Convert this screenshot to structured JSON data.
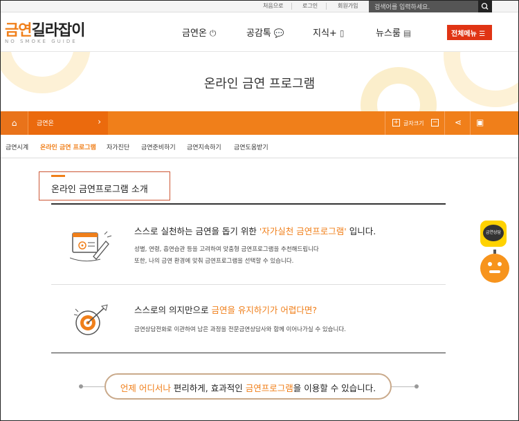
{
  "util_bar": {
    "links": [
      "처음으로",
      "로그인",
      "회원가입"
    ],
    "search_placeholder": "검색어를 입력하세요.",
    "search_icon": "search-icon"
  },
  "logo": {
    "text_orange": "금연",
    "text_dark": "길라잡이",
    "subtitle": "NO SMOKE GUIDE"
  },
  "gnb": [
    {
      "label": "금연온",
      "icon": "power-icon"
    },
    {
      "label": "공감톡",
      "icon": "chat-bubble-icon"
    },
    {
      "label": "지식+",
      "icon": "book-icon"
    },
    {
      "label": "뉴스룸",
      "icon": "newspaper-icon"
    }
  ],
  "all_menu": {
    "label": "전체메뉴",
    "icon": "menu-icon"
  },
  "hero": {
    "title": "온라인 금연 프로그램"
  },
  "navbar": {
    "home_icon": "home-icon",
    "current": "금연온",
    "font_size_label": "글자크기",
    "share_icon": "share-icon",
    "print_icon": "print-icon"
  },
  "subtabs": [
    "금연시계",
    "온라인 금연 프로그램",
    "자가진단",
    "금연준비하기",
    "금연지속하기",
    "금연도움받기"
  ],
  "section": {
    "title": "온라인 금연프로그램 소개"
  },
  "block1": {
    "head_pre": "스스로 실천하는 금연을 돕기 위한 ",
    "head_hl": "'자가실천 금연프로그램'",
    "head_post": " 입니다.",
    "desc1": "성별, 연령, 흡연습관 등을 고려하여 맞춤형 금연프로그램을 추천해드립니다",
    "desc2": "또한, 나의 금연 환경에 맞춰 금연프로그램을 선택할 수 있습니다."
  },
  "block2": {
    "head_pre": "스스로의 의지만으로 ",
    "head_hl": "금연을 유지하기가 어렵다면?",
    "desc1": "금연상담전화로 이관하여 남은 과정을 전문금연상담사와 함께 이어나가실 수 있습니다."
  },
  "banner": {
    "hl1": "언제 어디서나",
    "mid": " 편리하게, 효과적인 ",
    "hl2": "금연프로그램",
    "post": "을 이용할 수 있습니다."
  },
  "float": {
    "consult_label": "금연상담"
  },
  "colors": {
    "accent": "#f07f1a",
    "menu_red": "#e03414",
    "consult_yellow": "#ffd200"
  }
}
